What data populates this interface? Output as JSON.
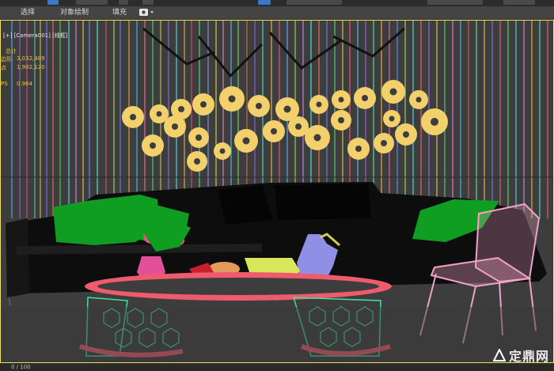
{
  "menubar": {
    "items": [
      "选择",
      "对象绘制",
      "填充"
    ]
  },
  "viewport": {
    "label": "[+] [Camera001] [线框]",
    "stats": {
      "title": "总计",
      "polys_label": "边形",
      "polys_value": "3,032,489",
      "verts_label": "点",
      "verts_value": "1,902,120",
      "fps_label": "PS",
      "fps_value": "0.964"
    }
  },
  "statusbar": {
    "frame": "0 / 100"
  },
  "watermark": {
    "text": "定鼎网"
  },
  "colors": {
    "viewport_bg": "#3d3d3d",
    "viewport_border": "#f3e25a",
    "stat_color": "#f1c232",
    "flower_yellow": "#f2d06b",
    "pillow_green": "#0f9e21",
    "chair_pink": "#f1a3c7",
    "table_red": "#ef5a6c",
    "table_legs": "#3ee3a3"
  }
}
